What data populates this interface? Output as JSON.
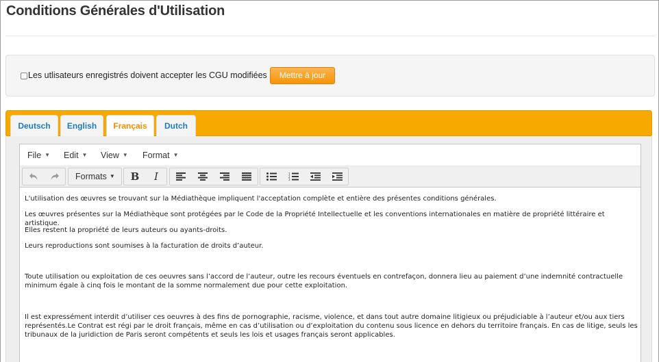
{
  "page": {
    "title": "Conditions Générales d'Utilisation"
  },
  "cgu_settings": {
    "checkbox_label": "Les utlisateurs enregistrés doivent accepter les CGU modifiées",
    "checkbox_checked": false,
    "update_button": "Mettre à jour"
  },
  "tabs": [
    {
      "label": "Deutsch",
      "active": false
    },
    {
      "label": "English",
      "active": false
    },
    {
      "label": "Français",
      "active": true
    },
    {
      "label": "Dutch",
      "active": false
    }
  ],
  "editor": {
    "menu": [
      {
        "label": "File"
      },
      {
        "label": "Edit"
      },
      {
        "label": "View"
      },
      {
        "label": "Format"
      }
    ],
    "toolbar": {
      "formats_label": "Formats",
      "buttons": [
        "undo-icon",
        "redo-icon",
        "bold-icon",
        "italic-icon",
        "align-left-icon",
        "align-center-icon",
        "align-right-icon",
        "align-justify-icon",
        "bullet-list-icon",
        "numbered-list-icon",
        "outdent-icon",
        "indent-icon"
      ]
    },
    "paragraphs": [
      "L'utilisation des œuvres se trouvant sur la Médiathèque impliquent l'acceptation complète et entière des présentes conditions générales.",
      "Les œuvres présentes sur la Médiathèque sont protégées par le Code de la Propriété Intellectuelle et les conventions internationales en matière de propriété littéraire et artistique.",
      "Elles restent la propriété de leurs auteurs ou ayants-droits.",
      "Leurs reproductions sont soumises à la facturation de droits d’auteur.",
      "Toute utilisation ou exploitation de ces oeuvres sans l’accord de l’auteur, outre les recours éventuels en contrefaçon, donnera lieu au paiement d’une indemnité contractuelle\nminimum égale à cinq fois le montant de la somme normalement due pour cette exploitation.",
      "Il est expressément interdit d’utiliser ces oeuvres à des fins de pornographie, racisme, violence, et dans tout autre domaine litigieux ou préjudiciable à l’auteur et/ou aux tiers\nreprésentés.Le Contrat est régi par le droit français, même en cas d’utilisation ou d’exploitation du contenu sous licence en dehors du territoire français. En cas de litige, seuls les\ntribunaux de la juridiction de Paris seront compétents et seuls les lois et usages français seront applicables."
    ]
  },
  "colors": {
    "accent_orange": "#f7a900",
    "tab_text_blue": "#1e7bbd",
    "active_tab_text": "#f28f00"
  }
}
